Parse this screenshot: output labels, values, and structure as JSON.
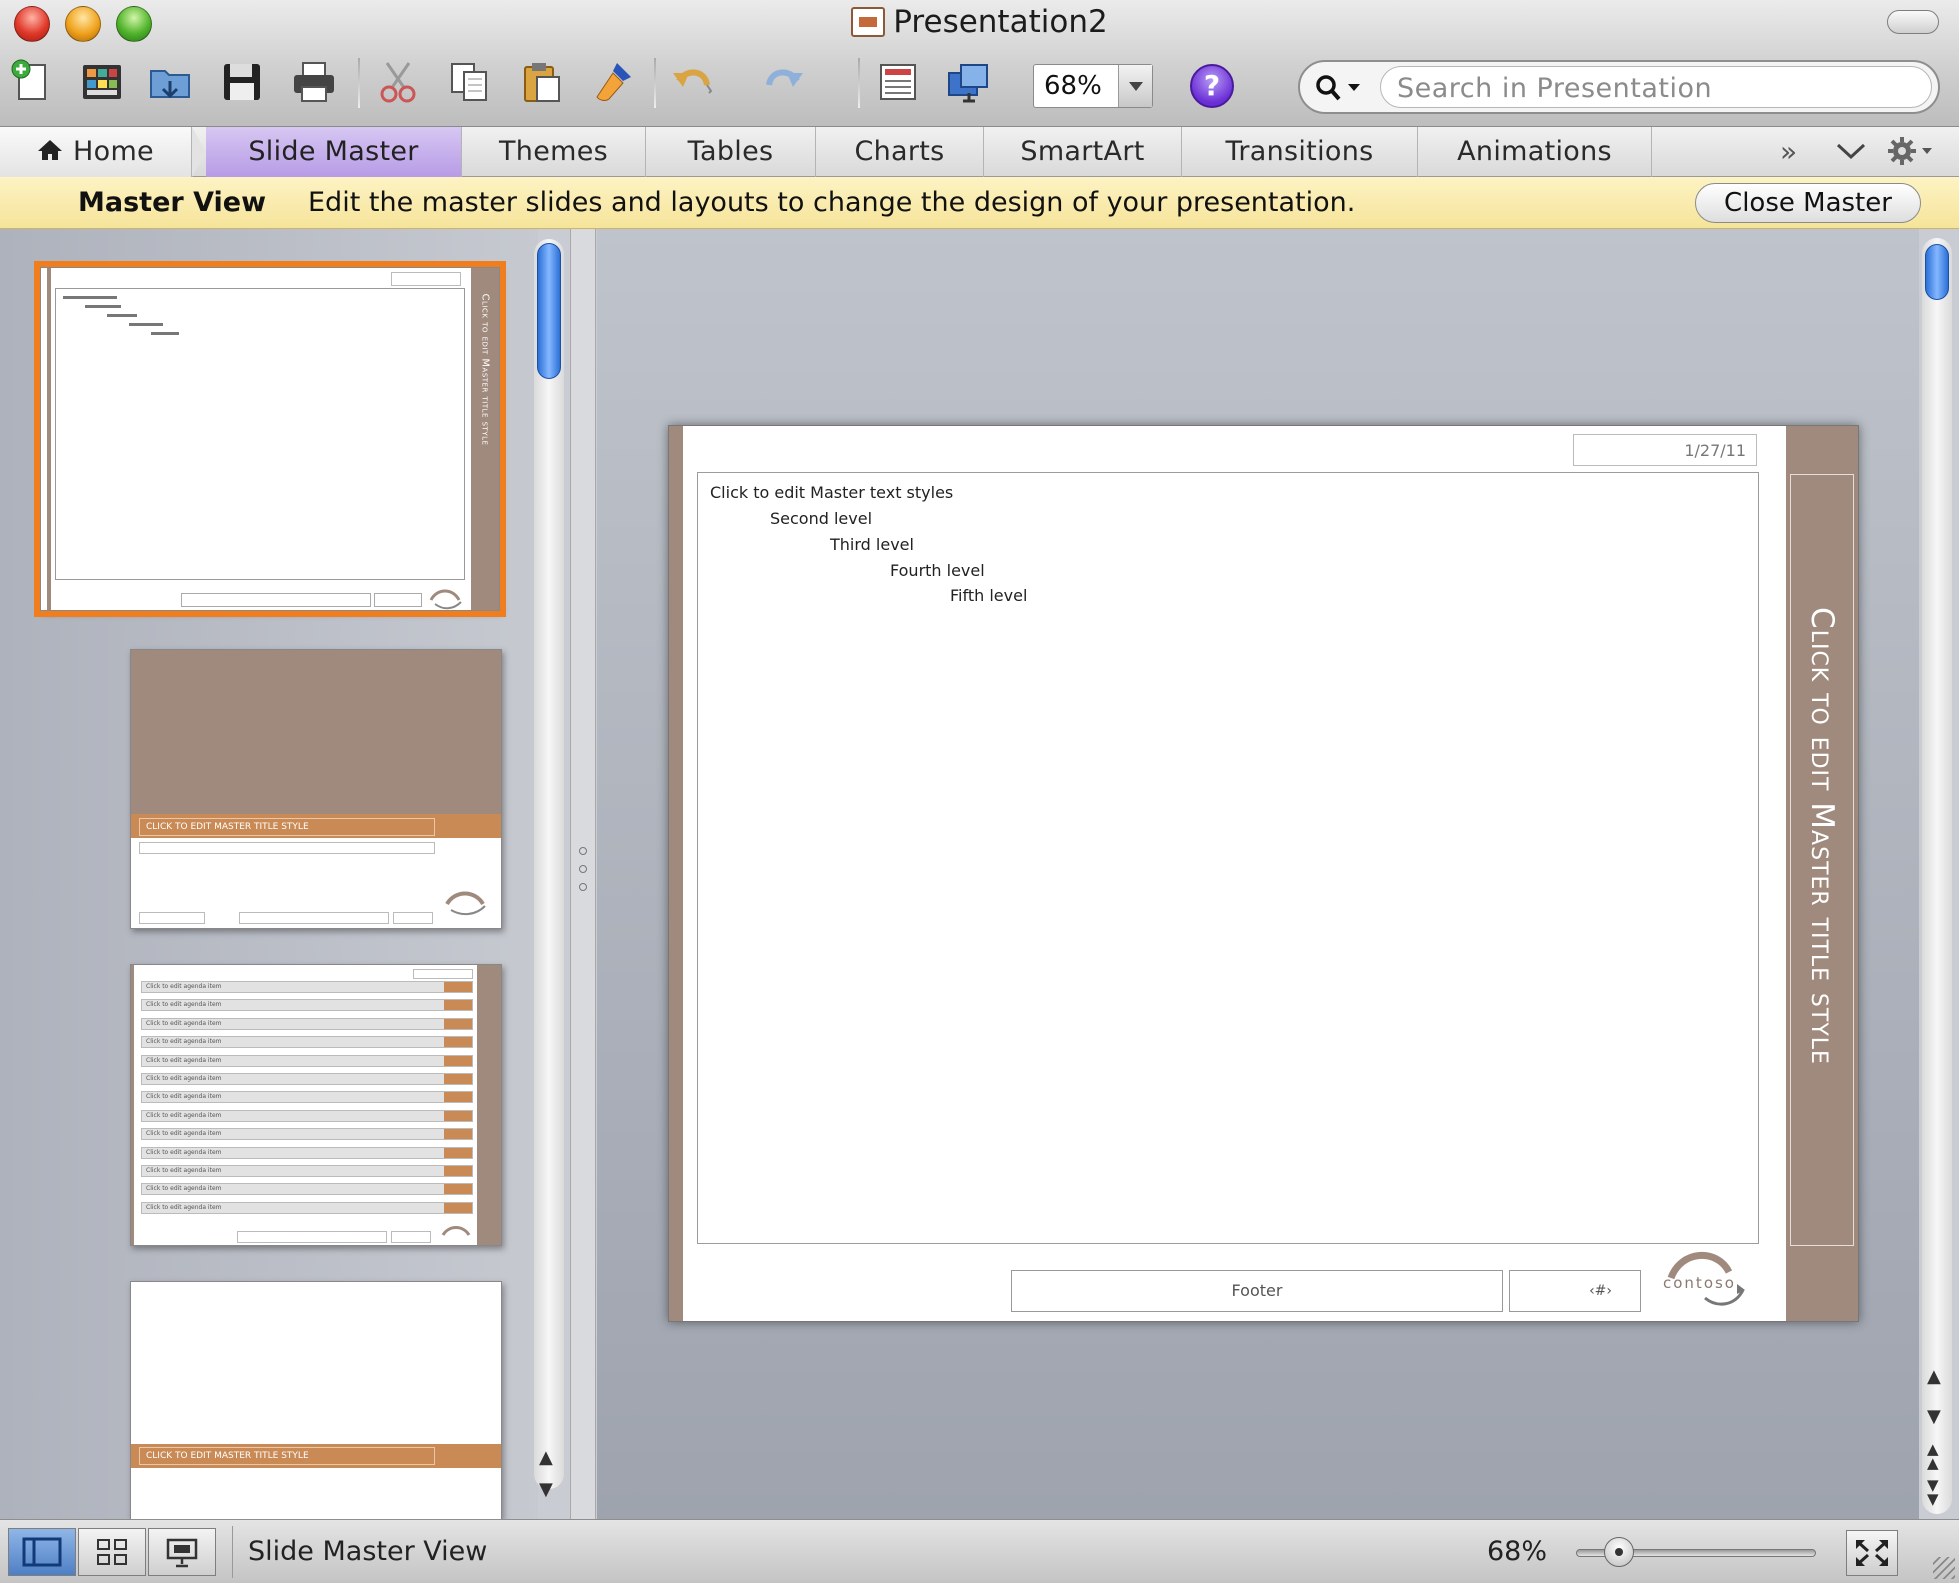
{
  "window": {
    "title": "Presentation2"
  },
  "toolbar": {
    "zoom_value": "68%",
    "help_label": "?",
    "search_placeholder": "Search in Presentation",
    "icons": [
      "new-icon",
      "gallery-icon",
      "open-icon",
      "save-icon",
      "print-icon",
      "cut-icon",
      "copy-icon",
      "paste-icon",
      "format-painter-icon",
      "undo-icon",
      "redo-icon",
      "slide-layout-icon",
      "media-icon"
    ]
  },
  "ribbon": {
    "tabs": [
      {
        "label": "Home"
      },
      {
        "label": "Slide Master"
      },
      {
        "label": "Themes"
      },
      {
        "label": "Tables"
      },
      {
        "label": "Charts"
      },
      {
        "label": "SmartArt"
      },
      {
        "label": "Transitions"
      },
      {
        "label": "Animations"
      }
    ],
    "active_tab": "Slide Master",
    "overflow_label": "»"
  },
  "master_bar": {
    "label": "Master View",
    "message": "Edit the master slides and layouts to change the design of your presentation.",
    "close_button": "Close Master"
  },
  "slide": {
    "date": "1/27/11",
    "title_placeholder": "Click to edit Master title style",
    "text_levels": [
      "Click to edit Master text styles",
      "Second level",
      "Third level",
      "Fourth level",
      "Fifth level"
    ],
    "footer": "Footer",
    "slide_number": "‹#›",
    "logo_text": "contoso"
  },
  "thumbnails": {
    "count_visible": 4,
    "selected_index": 0,
    "layout2_title": "CLICK TO EDIT MASTER TITLE STYLE",
    "layout4_title": "CLICK TO EDIT MASTER TITLE STYLE",
    "agenda_row_label": "Click to edit agenda item"
  },
  "status": {
    "view_label": "Slide Master View",
    "zoom": "68%",
    "zoom_fraction": 0.2
  },
  "colors": {
    "accent_orange": "#f07e1e",
    "theme_taupe": "#a08a7d",
    "theme_copper": "#c98a55",
    "ribbon_active": "#c6b0ee",
    "message_bar": "#f8e7a6"
  }
}
